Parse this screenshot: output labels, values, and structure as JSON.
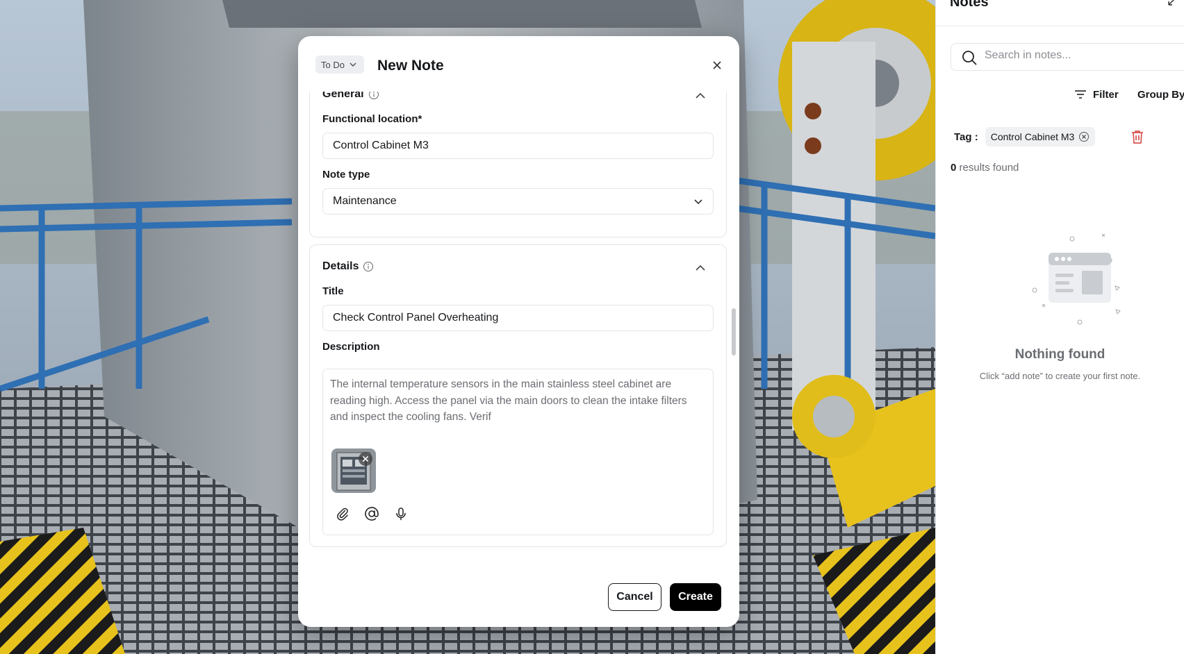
{
  "modal": {
    "status": "To Do",
    "title": "New Note",
    "general": {
      "heading": "General",
      "functional_location_label": "Functional location*",
      "functional_location_value": "Control Cabinet M3",
      "note_type_label": "Note type",
      "note_type_value": "Maintenance"
    },
    "details": {
      "heading": "Details",
      "title_label": "Title",
      "title_value": "Check Control Panel Overheating",
      "description_label": "Description",
      "description_value": "The internal temperature sensors in the main stainless steel cabinet are reading high. Access the panel via the main doors to clean the intake filters and inspect the cooling fans. Verif"
    },
    "cancel_label": "Cancel",
    "create_label": "Create"
  },
  "panel": {
    "title": "Notes",
    "search_placeholder": "Search in notes...",
    "filter_label": "Filter",
    "groupby_label": "Group By",
    "tag_label": "Tag :",
    "tag_value": "Control Cabinet M3",
    "results_count": "0",
    "results_text": "results found",
    "empty_title": "Nothing found",
    "empty_subtitle": "Click “add note” to create your first note."
  },
  "colors": {
    "accent": "#000000",
    "danger": "#d9534f",
    "crane_yellow": "#e8c21c",
    "rail_blue": "#2f6fb3"
  }
}
